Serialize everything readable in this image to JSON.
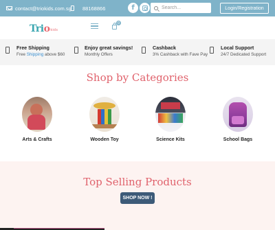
{
  "topbar": {
    "email": "contact@triokids.com.sg",
    "phone": "88168866",
    "social": [
      "facebook-icon",
      "instagram-icon",
      "youtube-icon"
    ],
    "search_placeholder": "Search...",
    "login_label": "Login/Registration",
    "bg_color": "#7fb3c9"
  },
  "header": {
    "logo_text_pre": "Tri",
    "logo_text_o": "o",
    "logo_sub": "kids",
    "cart_count": "0"
  },
  "features": [
    {
      "title": "Free Shipping",
      "sub_pre": "Free ",
      "sub_hl": "Shipping",
      "sub_post": " above $60",
      "icon": "mobile-icon"
    },
    {
      "title": "Enjoy great savings!",
      "sub": "Monthly Offers",
      "icon": "mobile-icon"
    },
    {
      "title": "Cashback",
      "sub": "3% Cashback with Fave Pay",
      "icon": "mobile-icon"
    },
    {
      "title": "Local Support",
      "sub": "24/7 Dedicated Support",
      "icon": "mobile-icon"
    }
  ],
  "categories": {
    "heading": "Shop by Categories",
    "items": [
      {
        "label": "Arts & Crafts"
      },
      {
        "label": "Wooden Toy"
      },
      {
        "label": "Science Kits"
      },
      {
        "label": "School Bags"
      }
    ]
  },
  "top_selling": {
    "heading": "Top Selling Products",
    "button_label": "SHOP NOW !"
  },
  "colors": {
    "accent": "#e0626c",
    "button": "#3d5a78",
    "teal": "#3aa6b0"
  }
}
